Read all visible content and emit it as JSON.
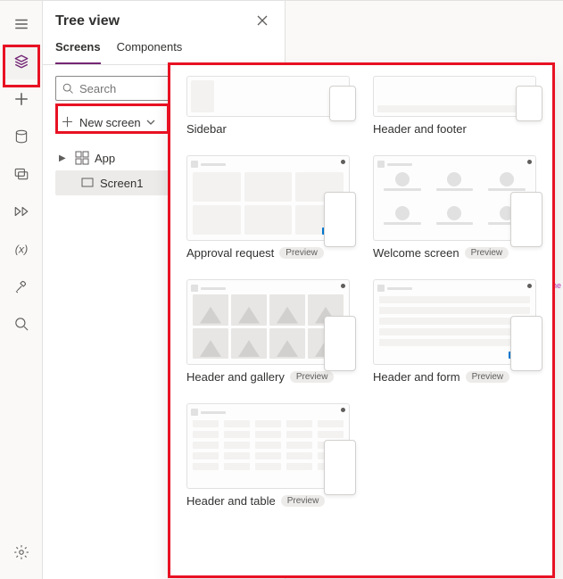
{
  "panel": {
    "title": "Tree view",
    "tabs": {
      "screens": "Screens",
      "components": "Components"
    },
    "search_placeholder": "Search",
    "new_screen_label": "New screen",
    "tree": {
      "app_label": "App",
      "screen1_label": "Screen1"
    }
  },
  "rail_icons": {
    "hamburger": "hamburger",
    "treeview": "treeview",
    "insert": "insert",
    "data": "data",
    "media": "media",
    "flows": "flows",
    "variables": "variables",
    "tools": "tools",
    "search": "search",
    "settings": "settings"
  },
  "layouts": {
    "row0": [
      {
        "label": "Sidebar",
        "preview": false
      },
      {
        "label": "Header and footer",
        "preview": false
      }
    ],
    "row1": [
      {
        "label": "Approval request",
        "preview": true
      },
      {
        "label": "Welcome screen",
        "preview": true
      }
    ],
    "row2": [
      {
        "label": "Header and gallery",
        "preview": true
      },
      {
        "label": "Header and form",
        "preview": true
      }
    ],
    "row3": [
      {
        "label": "Header and table",
        "preview": true
      }
    ],
    "preview_pill": "Preview"
  },
  "canvas_edge_text": "the"
}
